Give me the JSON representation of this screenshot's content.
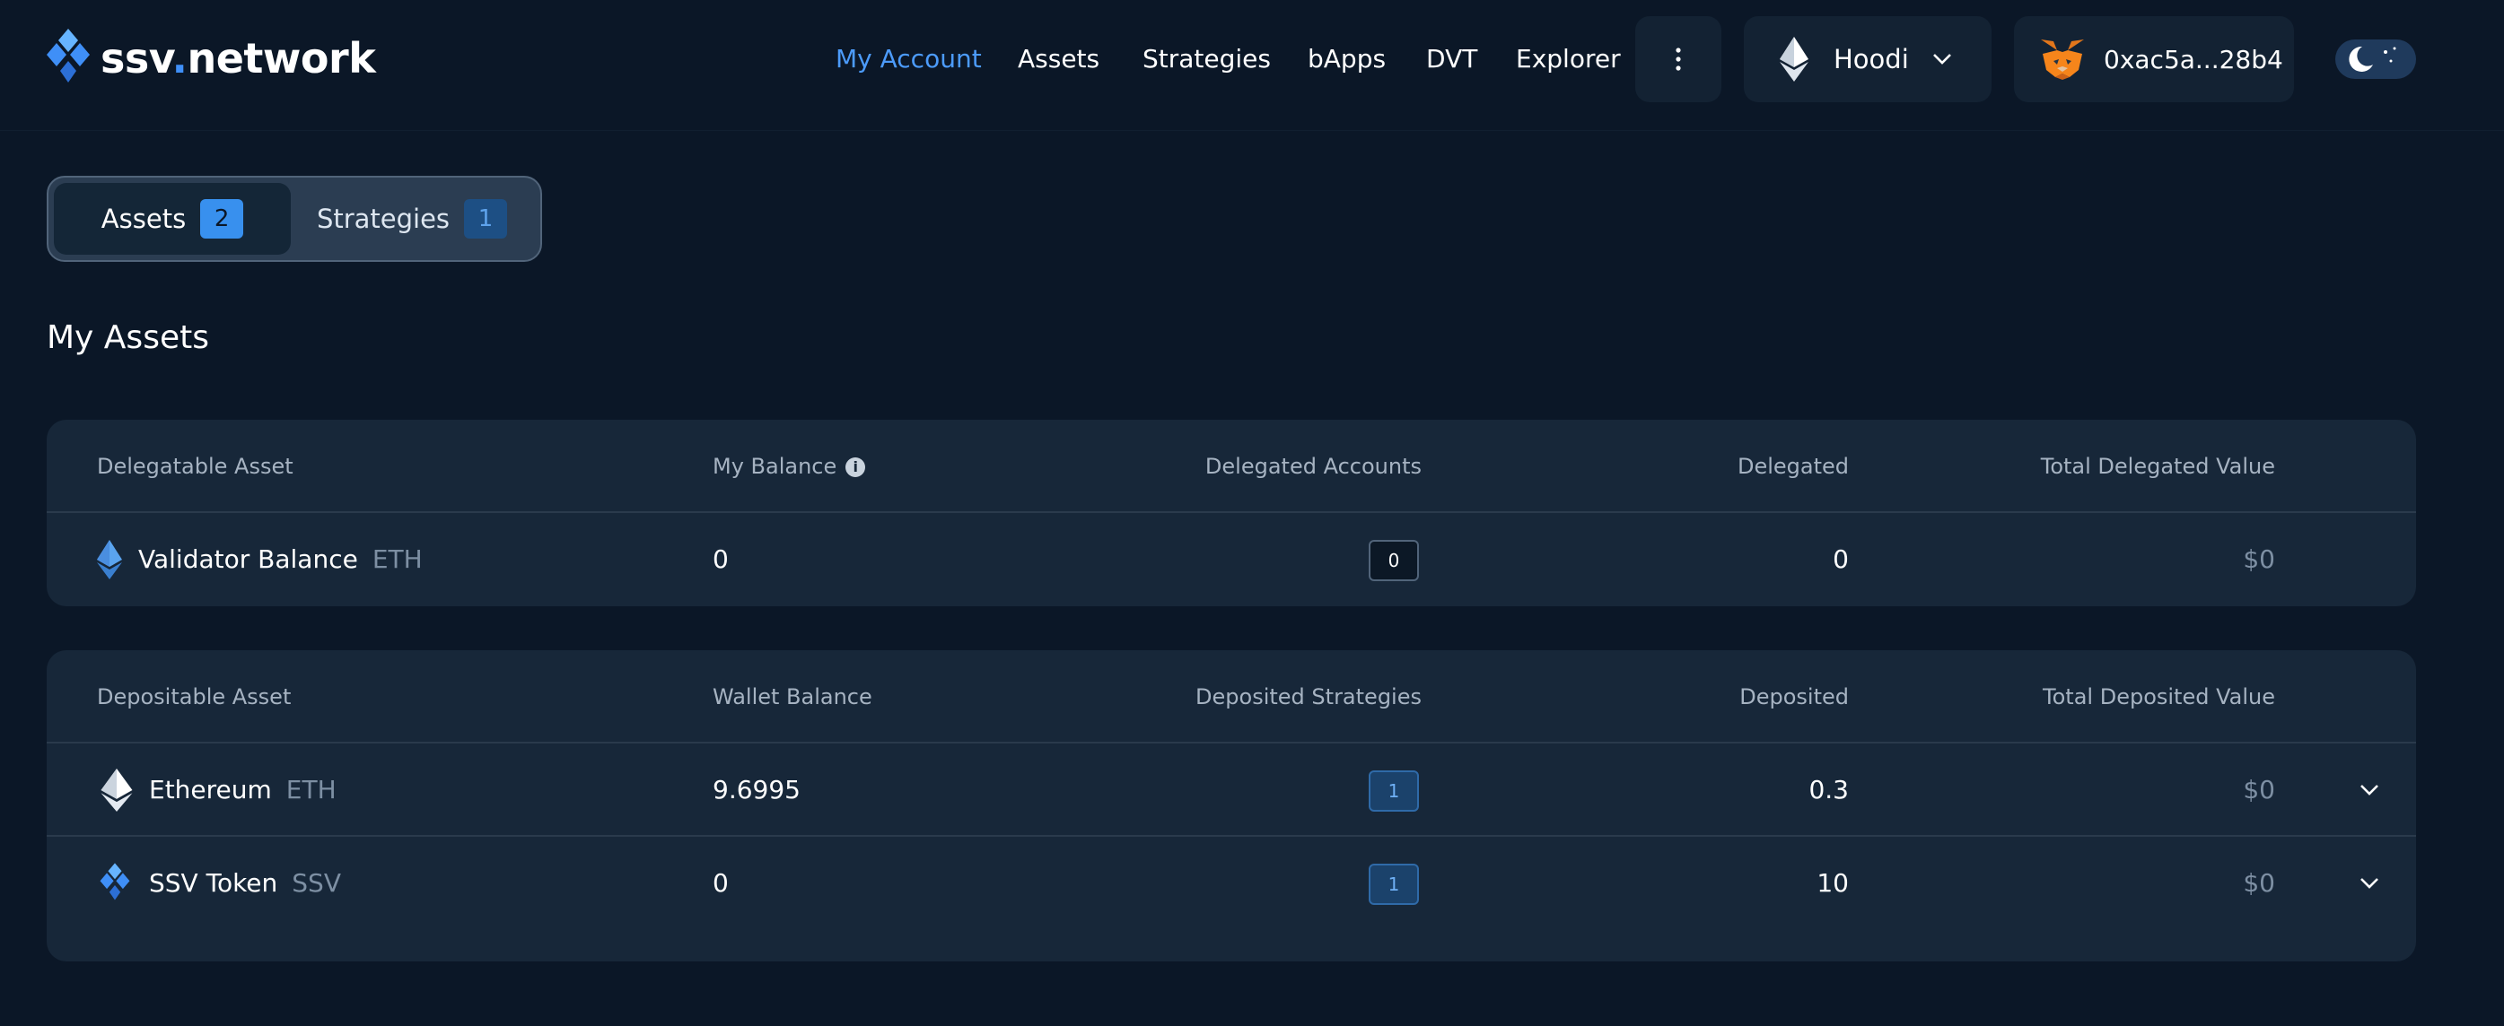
{
  "header": {
    "logo_prefix": "ssv",
    "logo_dot": ".",
    "logo_suffix": "network",
    "nav": [
      {
        "label": "My Account",
        "active": true
      },
      {
        "label": "Assets"
      },
      {
        "label": "Strategies"
      },
      {
        "label": "bApps"
      },
      {
        "label": "DVT"
      },
      {
        "label": "Explorer"
      }
    ],
    "network": "Hoodi",
    "wallet": "0xac5a...28b4",
    "icons": {
      "more": "more-vertical-icon",
      "network": "ethereum-icon",
      "wallet": "metamask-fox-icon",
      "theme": "moon-icon"
    }
  },
  "tabs": [
    {
      "label": "Assets",
      "count": "2",
      "active": true
    },
    {
      "label": "Strategies",
      "count": "1",
      "active": false
    }
  ],
  "section_title": "My Assets",
  "delegatable": {
    "columns": [
      "Delegatable Asset",
      "My Balance",
      "Delegated Accounts",
      "Delegated",
      "Total Delegated Value"
    ],
    "rows": [
      {
        "name": "Validator Balance",
        "symbol": "ETH",
        "balance": "0",
        "accounts": "0",
        "delegated": "0",
        "value": "$0"
      }
    ]
  },
  "depositable": {
    "columns": [
      "Depositable Asset",
      "Wallet Balance",
      "Deposited Strategies",
      "Deposited",
      "Total Deposited Value"
    ],
    "rows": [
      {
        "name": "Ethereum",
        "symbol": "ETH",
        "balance": "9.6995",
        "strategies": "1",
        "deposited": "0.3",
        "value": "$0"
      },
      {
        "name": "SSV Token",
        "symbol": "SSV",
        "balance": "0",
        "strategies": "1",
        "deposited": "10",
        "value": "$0"
      }
    ]
  },
  "colors": {
    "accent": "#4c9bfa",
    "background": "#0b1727",
    "card": "#172739"
  }
}
